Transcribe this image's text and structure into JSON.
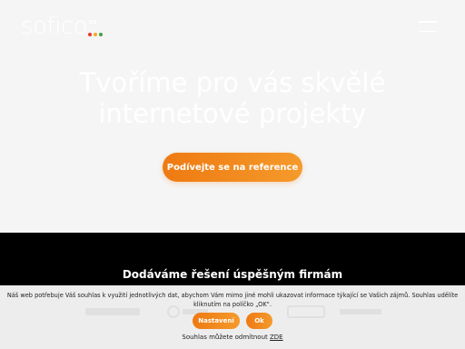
{
  "header": {
    "logo_text": "sofico",
    "logo_suffix": "cz",
    "logo_dot_colors": [
      "#e53935",
      "#f9a825",
      "#43a047"
    ],
    "menu_icon": "hamburger-icon"
  },
  "hero": {
    "headline_line1": "Tvoříme pro vás skvělé",
    "headline_line2": "internetové projekty",
    "cta_label": "Podívejte se na reference"
  },
  "clients": {
    "title": "Dodáváme řešení úspěšným firmám"
  },
  "cookie_bar": {
    "message_line1": "Náš web potřebuje Váš souhlas k využití jednotlivých dat, abychom Vám mimo jiné mohli ukazovat informace týkající se Vašich zájmů. Souhlas udělíte",
    "message_line2": "kliknutím na políčko „OK“.",
    "settings_label": "Nastavení",
    "ok_label": "Ok",
    "revoke_text": "Souhlas můžete odmítnout",
    "revoke_link": "ZDE"
  },
  "colors": {
    "accent": "#ee7a12",
    "hero_background": "#f5f5f5",
    "dark_band": "#000000"
  }
}
